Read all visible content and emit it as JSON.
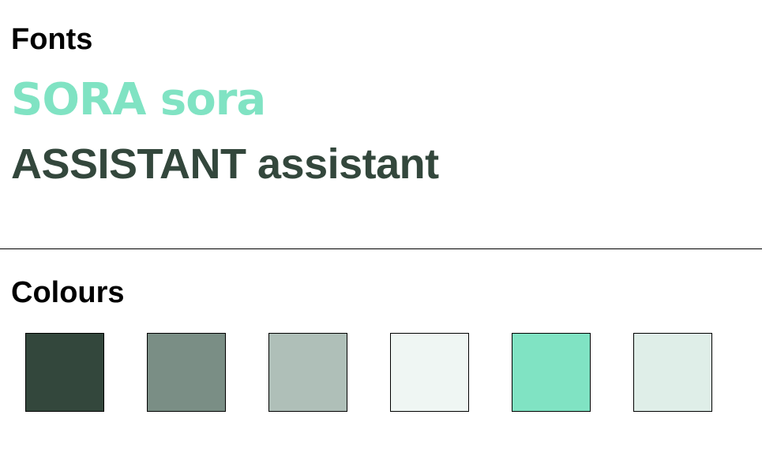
{
  "fonts": {
    "title": "Fonts",
    "samples": [
      {
        "text": "SORA sora",
        "color": "#80E3C3"
      },
      {
        "text": "ASSISTANT assistant",
        "color": "#33473C"
      }
    ]
  },
  "colours": {
    "title": "Colours",
    "swatches": [
      "#33473C",
      "#7A8E85",
      "#AFBFB8",
      "#EFF6F3",
      "#80E3C3",
      "#DFEEE8"
    ]
  }
}
